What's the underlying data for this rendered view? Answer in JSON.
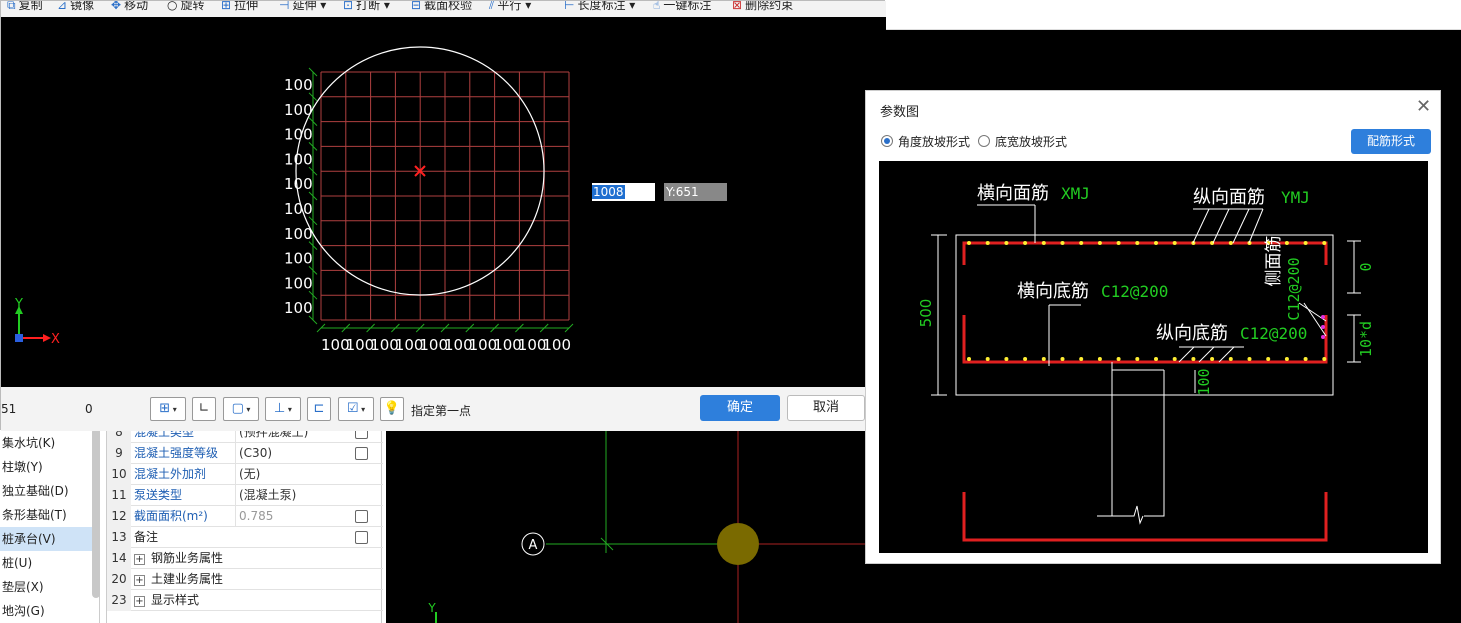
{
  "toolbar": {
    "copy": "复制",
    "mirror": "镜像",
    "move": "移动",
    "rotate": "旋转",
    "stretch": "拉伸",
    "extend": "延伸",
    "break": "打断",
    "section_check": "截面校验",
    "parallel": "平行",
    "length_dim": "长度标注",
    "one_key_dim": "一键标注",
    "delete_constraint": "删除约束"
  },
  "canvas": {
    "grid_labels_y": [
      "100",
      "100",
      "100",
      "100",
      "100",
      "100",
      "100",
      "100",
      "100",
      "100"
    ],
    "grid_labels_x": [
      "100",
      "100",
      "100",
      "100",
      "100",
      "100",
      "100",
      "100",
      "100",
      "100"
    ],
    "axis_y": "Y",
    "axis_x": "X",
    "coord_x_value": "1008",
    "coord_y_value": "Y:651"
  },
  "bottombar": {
    "coord_left_1": "51",
    "coord_left_2": "0",
    "prompt": "指定第一点",
    "ok": "确定",
    "cancel": "取消"
  },
  "tree": {
    "items": [
      {
        "label": "集水坑(K)",
        "selected": false
      },
      {
        "label": "柱墩(Y)",
        "selected": false
      },
      {
        "label": "独立基础(D)",
        "selected": false
      },
      {
        "label": "条形基础(T)",
        "selected": false
      },
      {
        "label": "桩承台(V)",
        "selected": true
      },
      {
        "label": "桩(U)",
        "selected": false
      },
      {
        "label": "垫层(X)",
        "selected": false
      },
      {
        "label": "地沟(G)",
        "selected": false
      }
    ]
  },
  "props": {
    "rows": [
      {
        "num": "8",
        "name": "混凝土类型",
        "value": "(预拌混凝土)",
        "check": true,
        "link": true
      },
      {
        "num": "9",
        "name": "混凝土强度等级",
        "value": "(C30)",
        "check": true,
        "link": true
      },
      {
        "num": "10",
        "name": "混凝土外加剂",
        "value": "(无)",
        "check": false,
        "link": true
      },
      {
        "num": "11",
        "name": "泵送类型",
        "value": "(混凝土泵)",
        "check": false,
        "link": true
      },
      {
        "num": "12",
        "name": "截面面积(m²)",
        "value": "0.785",
        "check": true,
        "link": true,
        "grey": true
      },
      {
        "num": "13",
        "name": "备注",
        "value": "",
        "check": true,
        "link": false
      },
      {
        "num": "14",
        "name": "钢筋业务属性",
        "value": "",
        "check": false,
        "link": false,
        "expand": true
      },
      {
        "num": "20",
        "name": "土建业务属性",
        "value": "",
        "check": false,
        "link": false,
        "expand": true
      },
      {
        "num": "23",
        "name": "显示样式",
        "value": "",
        "check": false,
        "link": false,
        "expand": true
      }
    ]
  },
  "bg_cad": {
    "axis_label": "A",
    "axis_y": "Y"
  },
  "param_dialog": {
    "title": "参数图",
    "radio_angle": "角度放坡形式",
    "radio_width": "底宽放坡形式",
    "rebar_button": "配筋形式",
    "labels": {
      "top_transverse": "横向面筋",
      "top_transverse_val": "XMJ",
      "top_longitudinal": "纵向面筋",
      "top_longitudinal_val": "YMJ",
      "bottom_transverse": "横向底筋",
      "bottom_transverse_val": "C12@200",
      "bottom_longitudinal": "纵向底筋",
      "bottom_longitudinal_val": "C12@200",
      "side": "侧面筋",
      "side_val": "C12@200",
      "height": "500",
      "dim_zero": "0",
      "dim_10d": "10*d",
      "dim_100": "100"
    }
  },
  "colors": {
    "accent": "#2e7fdc",
    "link": "#1f5fb3",
    "cad_green": "#22cc22",
    "cad_red": "#e02020",
    "grid_red": "#b04040"
  }
}
